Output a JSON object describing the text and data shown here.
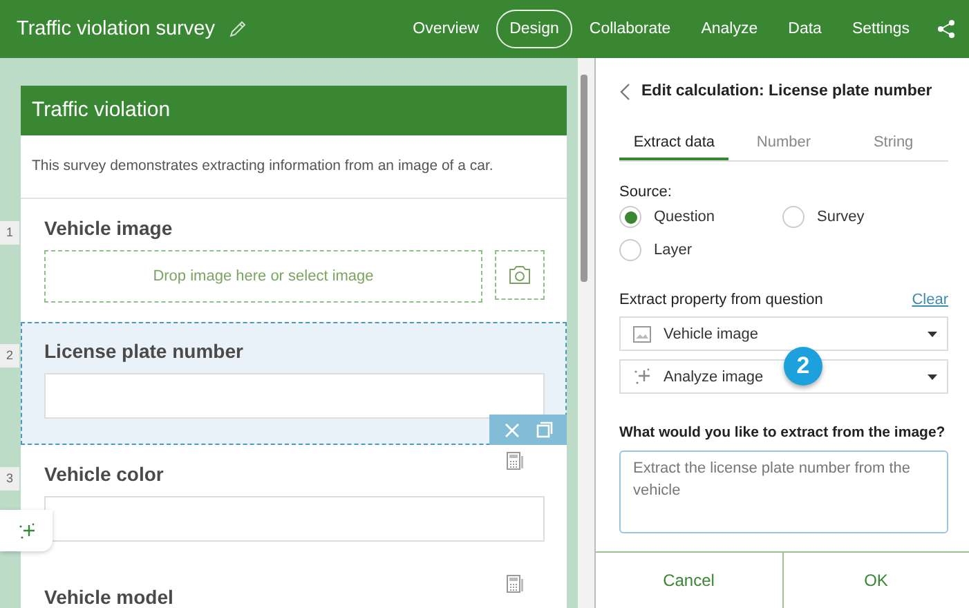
{
  "app_bar": {
    "title": "Traffic violation survey",
    "nav": [
      {
        "label": "Overview",
        "selected": false
      },
      {
        "label": "Design",
        "selected": true
      },
      {
        "label": "Collaborate",
        "selected": false
      },
      {
        "label": "Analyze",
        "selected": false
      },
      {
        "label": "Data",
        "selected": false
      },
      {
        "label": "Settings",
        "selected": false
      }
    ]
  },
  "form": {
    "title": "Traffic violation",
    "description": "This survey demonstrates extracting information from an image of a car.",
    "questions": [
      {
        "number": "1",
        "label": "Vehicle image",
        "kind": "image",
        "placeholder": "Drop image here or select image",
        "selected": false,
        "calculated": false
      },
      {
        "number": "2",
        "label": "License plate number",
        "kind": "text",
        "selected": true,
        "calculated": false
      },
      {
        "number": "3",
        "label": "Vehicle color",
        "kind": "text",
        "selected": false,
        "calculated": true
      },
      {
        "label": "Vehicle model",
        "selected": false,
        "calculated": true
      }
    ]
  },
  "panel": {
    "title": "Edit calculation: License plate number",
    "tabs": [
      {
        "label": "Extract data",
        "selected": true
      },
      {
        "label": "Number",
        "selected": false
      },
      {
        "label": "String",
        "selected": false
      }
    ],
    "source_label": "Source:",
    "source_options": [
      {
        "label": "Question",
        "selected": true
      },
      {
        "label": "Survey",
        "selected": false
      },
      {
        "label": "Layer",
        "selected": false
      }
    ],
    "property_label": "Extract property from question",
    "clear_link": "Clear",
    "selects": [
      {
        "value": "Vehicle image",
        "kind": "question"
      },
      {
        "value": "Analyze image",
        "kind": "analyze"
      }
    ],
    "prompt_label": "What would you like to extract from the image?",
    "prompt_value": "Extract the license plate number from the vehicle",
    "buttons": [
      "Cancel",
      "OK"
    ]
  },
  "callout": "2"
}
